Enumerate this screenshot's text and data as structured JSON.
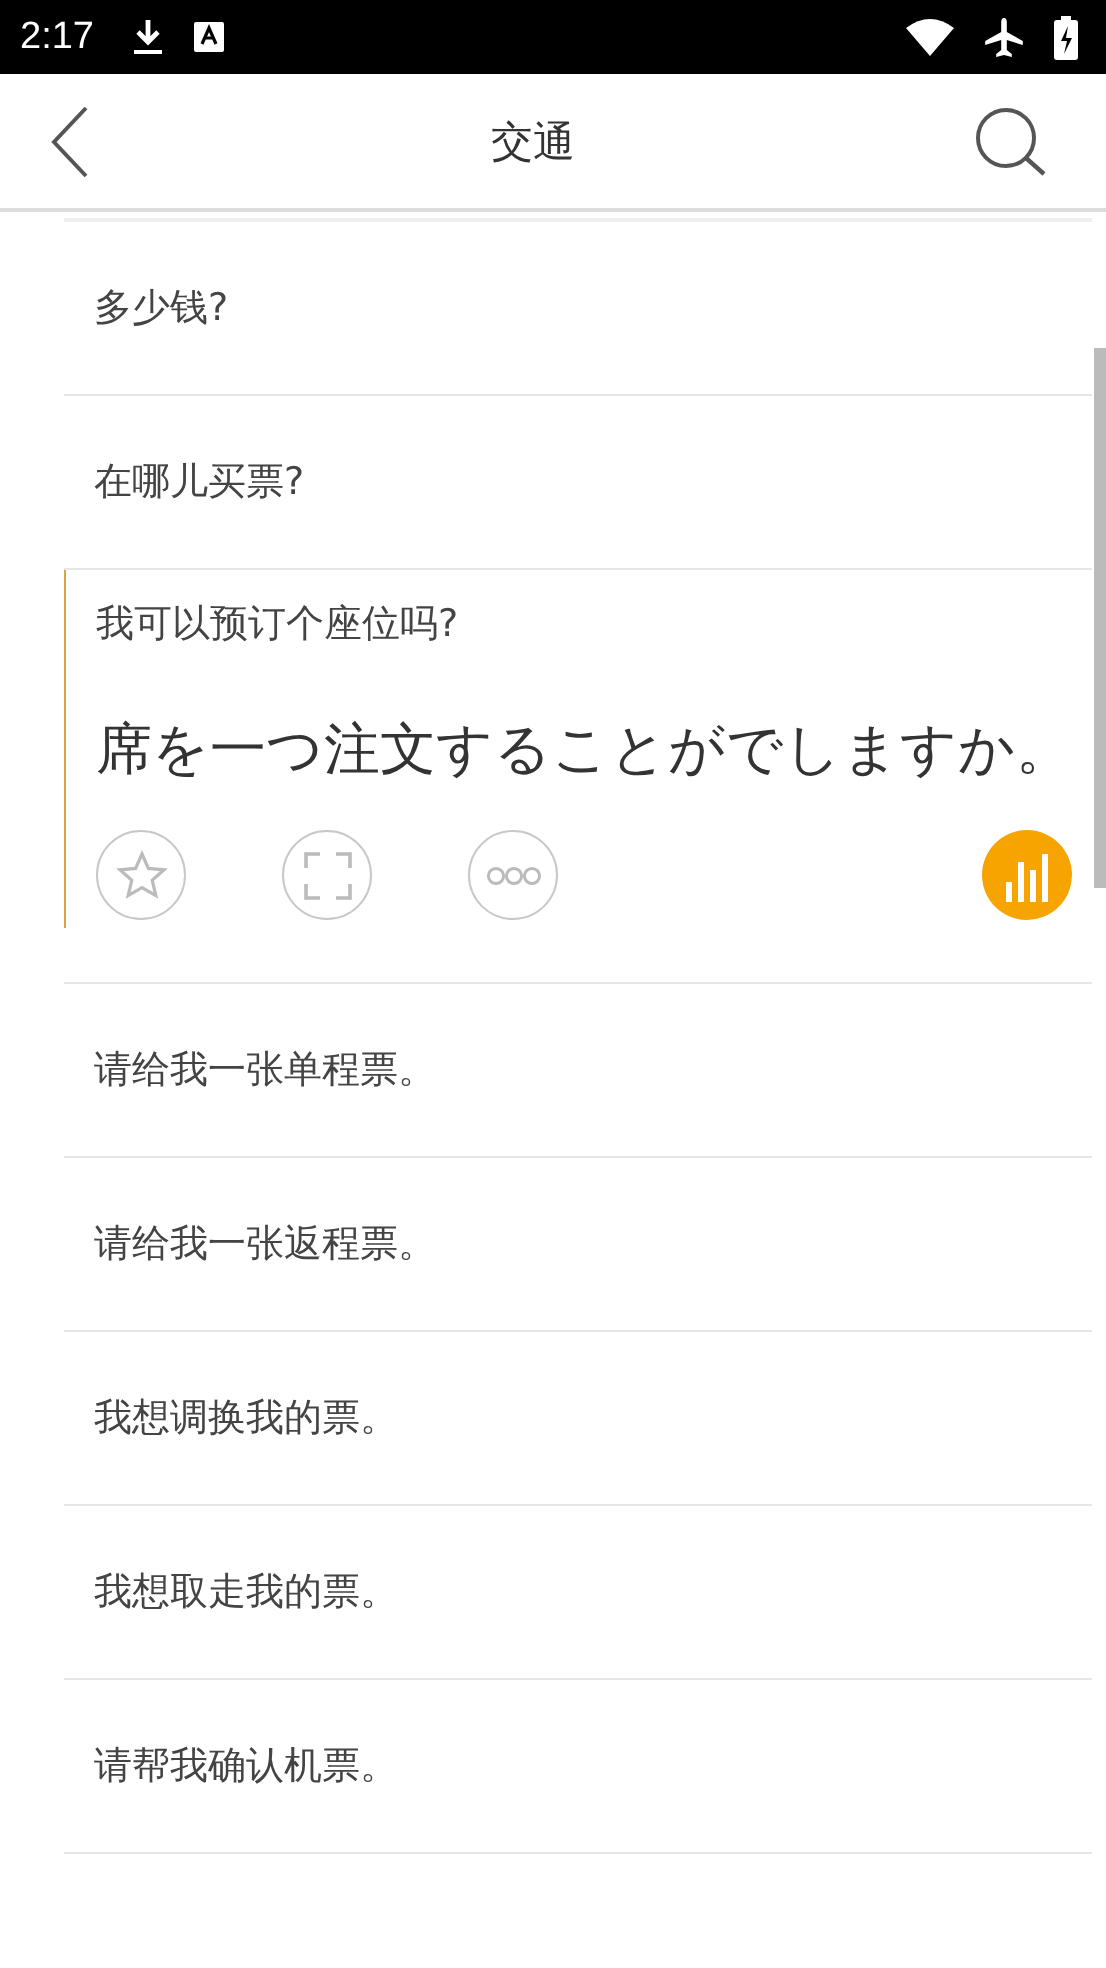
{
  "status_bar": {
    "time": "2:17"
  },
  "header": {
    "title": "交通"
  },
  "phrases": [
    {
      "text": "多少钱?",
      "expanded": false
    },
    {
      "text": "在哪儿买票?",
      "expanded": false
    },
    {
      "text": "我可以预订个座位吗?",
      "expanded": true,
      "translation": "席を一つ注文することがでしますか。"
    },
    {
      "text": "请给我一张单程票。",
      "expanded": false
    },
    {
      "text": "请给我一张返程票。",
      "expanded": false
    },
    {
      "text": "我想调换我的票。",
      "expanded": false
    },
    {
      "text": "我想取走我的票。",
      "expanded": false
    },
    {
      "text": "请帮我确认机票。",
      "expanded": false
    }
  ]
}
